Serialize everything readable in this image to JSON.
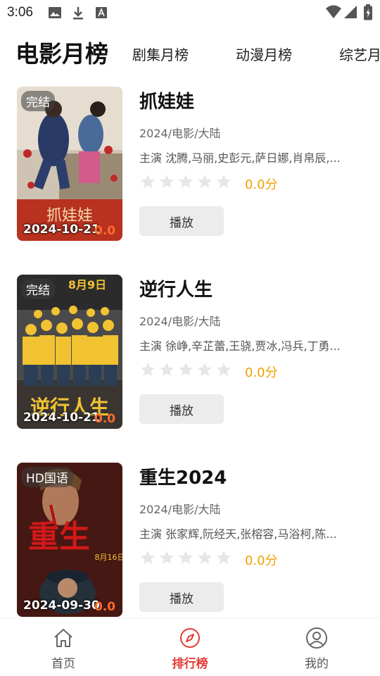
{
  "status_bar": {
    "time": "3:06",
    "icons": [
      "image-icon",
      "download-icon",
      "font-icon",
      "wifi-icon",
      "signal-icon",
      "battery-icon"
    ]
  },
  "tabs": [
    {
      "label": "电影月榜",
      "active": true
    },
    {
      "label": "剧集月榜",
      "active": false
    },
    {
      "label": "动漫月榜",
      "active": false
    },
    {
      "label": "综艺月榜",
      "active": false
    }
  ],
  "movies": [
    {
      "badge": "完结",
      "poster_date": "2024-10-21",
      "poster_score": "0.0",
      "title": "抓娃娃",
      "meta": "2024/电影/大陆",
      "cast": "主演 沈腾,马丽,史彭元,萨日娜,肖帛辰,...",
      "rating_stars": 0,
      "score": "0.0分",
      "play_label": "播放"
    },
    {
      "badge": "完结",
      "poster_date": "2024-10-21",
      "poster_score": "0.0",
      "title": "逆行人生",
      "meta": "2024/电影/大陆",
      "cast": "主演 徐峥,辛芷蕾,王骁,贾冰,冯兵,丁勇...",
      "rating_stars": 0,
      "score": "0.0分",
      "play_label": "播放"
    },
    {
      "badge": "HD国语",
      "poster_date": "2024-09-30",
      "poster_score": "0.0",
      "title": "重生2024",
      "meta": "2024/电影/大陆",
      "cast": "主演 张家辉,阮经天,张榕容,马浴柯,陈...",
      "rating_stars": 0,
      "score": "0.0分",
      "play_label": "播放"
    }
  ],
  "bottom_nav": [
    {
      "label": "首页",
      "icon": "home-icon",
      "active": false
    },
    {
      "label": "排行榜",
      "icon": "compass-icon",
      "active": true
    },
    {
      "label": "我的",
      "icon": "profile-icon",
      "active": false
    }
  ],
  "colors": {
    "accent": "#e53935",
    "score": "#f0a000",
    "poster_score": "#ff6a2b",
    "star_empty": "#e6e6e6"
  }
}
